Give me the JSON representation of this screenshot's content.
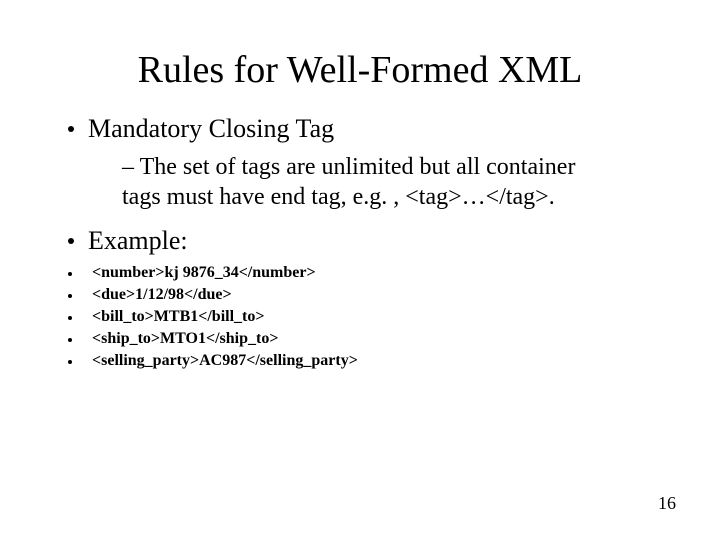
{
  "title": "Rules for Well-Formed XML",
  "bullet1": "Mandatory Closing Tag",
  "sub1_prefix": "– ",
  "sub1": "The set of tags are unlimited but all container tags must have end tag, e.g. , <tag>…</tag>.",
  "bullet2": "Example:",
  "code": {
    "line1": "<number>kj 9876_34</number>",
    "line2": "<due>1/12/98</due>",
    "line3": "<bill_to>MTB1</bill_to>",
    "line4": "<ship_to>MTO1</ship_to>",
    "line5": "<selling_party>AC987</selling_party>"
  },
  "page_number": "16"
}
